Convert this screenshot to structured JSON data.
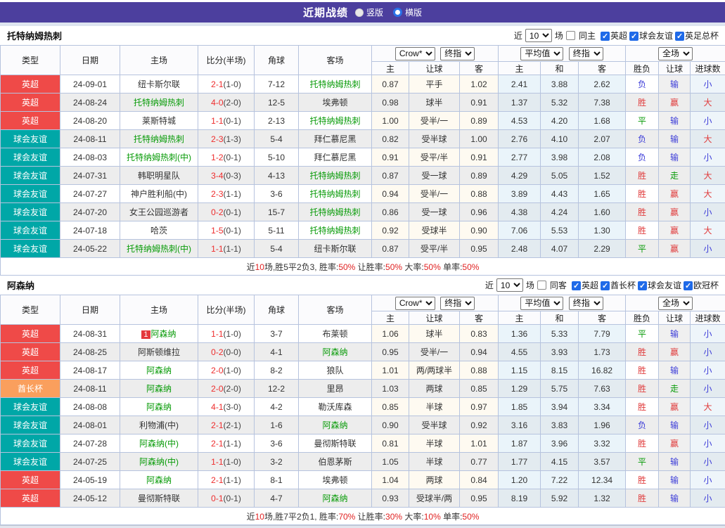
{
  "colors": {
    "topbar_purple": "#4c3f9e",
    "epl_red": "#ef4a48",
    "friendly_teal": "#00a7a7",
    "emirates_orange": "#fa9f5d",
    "team_green": "#089b08",
    "score_red": "#ee2c2c",
    "win_red": "#e03a3a",
    "lose_blue": "#3c3cd8",
    "draw_green": "#089b08",
    "border_blue": "#b6c3de"
  },
  "icons": {
    "checkbox_check": "✓",
    "radio_selected": "blue-ring-circle"
  },
  "topbar": {
    "title": "近期战绩",
    "radios": [
      {
        "label": "竖版",
        "checked": false
      },
      {
        "label": "横版",
        "checked": true
      }
    ]
  },
  "sections": [
    {
      "team": "托特纳姆热刺",
      "controls": {
        "near": "近",
        "count": "10",
        "games": "场",
        "same": "同主",
        "same_checked": false,
        "leagues": [
          "英超",
          "球会友谊",
          "英足总杯"
        ]
      },
      "columns": {
        "type": "类型",
        "date": "日期",
        "home": "主场",
        "score": "比分(半场)",
        "corner": "角球",
        "away": "客场"
      },
      "selects": {
        "book": "Crow*",
        "book_stage": "终指",
        "avg": "平均值",
        "avg_stage": "终指",
        "scope": "全场"
      },
      "sub_headers": [
        "主",
        "让球",
        "客",
        "主",
        "和",
        "客",
        "胜负",
        "让球",
        "进球数"
      ],
      "rows": [
        {
          "type": "英超",
          "tc": "epl",
          "date": "24-09-01",
          "badge": "",
          "home": "纽卡斯尔联",
          "home_green": false,
          "score": "2-1",
          "half": "(1-0)",
          "corner": "7-12",
          "away": "托特纳姆热刺",
          "away_green": true,
          "handicap": [
            "0.87",
            "平手",
            "1.02"
          ],
          "europe": [
            "2.41",
            "3.88",
            "2.62"
          ],
          "results": [
            [
              "负",
              "b"
            ],
            [
              "输",
              "b"
            ],
            [
              "小",
              "b"
            ]
          ]
        },
        {
          "type": "英超",
          "tc": "epl",
          "date": "24-08-24",
          "badge": "",
          "home": "托特纳姆热刺",
          "home_green": true,
          "score": "4-0",
          "half": "(2-0)",
          "corner": "12-5",
          "away": "埃弗顿",
          "away_green": false,
          "handicap": [
            "0.98",
            "球半",
            "0.91"
          ],
          "europe": [
            "1.37",
            "5.32",
            "7.38"
          ],
          "results": [
            [
              "胜",
              "r"
            ],
            [
              "赢",
              "r"
            ],
            [
              "大",
              "r"
            ]
          ]
        },
        {
          "type": "英超",
          "tc": "epl",
          "date": "24-08-20",
          "badge": "",
          "home": "莱斯特城",
          "home_green": false,
          "score": "1-1",
          "half": "(0-1)",
          "corner": "2-13",
          "away": "托特纳姆热刺",
          "away_green": true,
          "handicap": [
            "1.00",
            "受半/一",
            "0.89"
          ],
          "europe": [
            "4.53",
            "4.20",
            "1.68"
          ],
          "results": [
            [
              "平",
              "g"
            ],
            [
              "输",
              "b"
            ],
            [
              "小",
              "b"
            ]
          ]
        },
        {
          "type": "球会友谊",
          "tc": "fr",
          "date": "24-08-11",
          "badge": "",
          "home": "托特纳姆热刺",
          "home_green": true,
          "score": "2-3",
          "half": "(1-3)",
          "corner": "5-4",
          "away": "拜仁慕尼黑",
          "away_green": false,
          "handicap": [
            "0.82",
            "受半球",
            "1.00"
          ],
          "europe": [
            "2.76",
            "4.10",
            "2.07"
          ],
          "results": [
            [
              "负",
              "b"
            ],
            [
              "输",
              "b"
            ],
            [
              "大",
              "r"
            ]
          ]
        },
        {
          "type": "球会友谊",
          "tc": "fr",
          "date": "24-08-03",
          "badge": "",
          "home": "托特纳姆热刺(中)",
          "home_green": true,
          "score": "1-2",
          "half": "(0-1)",
          "corner": "5-10",
          "away": "拜仁慕尼黑",
          "away_green": false,
          "handicap": [
            "0.91",
            "受平/半",
            "0.91"
          ],
          "europe": [
            "2.77",
            "3.98",
            "2.08"
          ],
          "results": [
            [
              "负",
              "b"
            ],
            [
              "输",
              "b"
            ],
            [
              "小",
              "b"
            ]
          ]
        },
        {
          "type": "球会友谊",
          "tc": "fr",
          "date": "24-07-31",
          "badge": "",
          "home": "韩职明星队",
          "home_green": false,
          "score": "3-4",
          "half": "(0-3)",
          "corner": "4-13",
          "away": "托特纳姆热刺",
          "away_green": true,
          "handicap": [
            "0.87",
            "受一球",
            "0.89"
          ],
          "europe": [
            "4.29",
            "5.05",
            "1.52"
          ],
          "results": [
            [
              "胜",
              "r"
            ],
            [
              "走",
              "g"
            ],
            [
              "大",
              "r"
            ]
          ]
        },
        {
          "type": "球会友谊",
          "tc": "fr",
          "date": "24-07-27",
          "badge": "",
          "home": "神户胜利船(中)",
          "home_green": false,
          "score": "2-3",
          "half": "(1-1)",
          "corner": "3-6",
          "away": "托特纳姆热刺",
          "away_green": true,
          "handicap": [
            "0.94",
            "受半/一",
            "0.88"
          ],
          "europe": [
            "3.89",
            "4.43",
            "1.65"
          ],
          "results": [
            [
              "胜",
              "r"
            ],
            [
              "赢",
              "r"
            ],
            [
              "大",
              "r"
            ]
          ]
        },
        {
          "type": "球会友谊",
          "tc": "fr",
          "date": "24-07-20",
          "badge": "",
          "home": "女王公园巡游者",
          "home_green": false,
          "score": "0-2",
          "half": "(0-1)",
          "corner": "15-7",
          "away": "托特纳姆热刺",
          "away_green": true,
          "handicap": [
            "0.86",
            "受一球",
            "0.96"
          ],
          "europe": [
            "4.38",
            "4.24",
            "1.60"
          ],
          "results": [
            [
              "胜",
              "r"
            ],
            [
              "赢",
              "r"
            ],
            [
              "小",
              "b"
            ]
          ]
        },
        {
          "type": "球会友谊",
          "tc": "fr",
          "date": "24-07-18",
          "badge": "",
          "home": "哈茨",
          "home_green": false,
          "score": "1-5",
          "half": "(0-1)",
          "corner": "5-11",
          "away": "托特纳姆热刺",
          "away_green": true,
          "handicap": [
            "0.92",
            "受球半",
            "0.90"
          ],
          "europe": [
            "7.06",
            "5.53",
            "1.30"
          ],
          "results": [
            [
              "胜",
              "r"
            ],
            [
              "赢",
              "r"
            ],
            [
              "大",
              "r"
            ]
          ]
        },
        {
          "type": "球会友谊",
          "tc": "fr",
          "date": "24-05-22",
          "badge": "",
          "home": "托特纳姆热刺(中)",
          "home_green": true,
          "score": "1-1",
          "half": "(1-1)",
          "corner": "5-4",
          "away": "纽卡斯尔联",
          "away_green": false,
          "handicap": [
            "0.87",
            "受平/半",
            "0.95"
          ],
          "europe": [
            "2.48",
            "4.07",
            "2.29"
          ],
          "results": [
            [
              "平",
              "g"
            ],
            [
              "赢",
              "r"
            ],
            [
              "小",
              "b"
            ]
          ]
        }
      ],
      "summary": [
        [
          "近",
          false
        ],
        [
          "10",
          true
        ],
        [
          "场,胜5平2负3, 胜率:",
          false
        ],
        [
          "50%",
          true
        ],
        [
          " 让胜率:",
          false
        ],
        [
          "50%",
          true
        ],
        [
          " 大率:",
          false
        ],
        [
          "50%",
          true
        ],
        [
          " 单率:",
          false
        ],
        [
          "50%",
          true
        ]
      ]
    },
    {
      "team": "阿森纳",
      "controls": {
        "near": "近",
        "count": "10",
        "games": "场",
        "same": "同客",
        "same_checked": false,
        "leagues": [
          "英超",
          "酋长杯",
          "球会友谊",
          "欧冠杯"
        ]
      },
      "columns": {
        "type": "类型",
        "date": "日期",
        "home": "主场",
        "score": "比分(半场)",
        "corner": "角球",
        "away": "客场"
      },
      "selects": {
        "book": "Crow*",
        "book_stage": "终指",
        "avg": "平均值",
        "avg_stage": "终指",
        "scope": "全场"
      },
      "sub_headers": [
        "主",
        "让球",
        "客",
        "主",
        "和",
        "客",
        "胜负",
        "让球",
        "进球数"
      ],
      "rows": [
        {
          "type": "英超",
          "tc": "epl",
          "date": "24-08-31",
          "badge": "1",
          "home": "阿森纳",
          "home_green": true,
          "score": "1-1",
          "half": "(1-0)",
          "corner": "3-7",
          "away": "布莱顿",
          "away_green": false,
          "handicap": [
            "1.06",
            "球半",
            "0.83"
          ],
          "europe": [
            "1.36",
            "5.33",
            "7.79"
          ],
          "results": [
            [
              "平",
              "g"
            ],
            [
              "输",
              "b"
            ],
            [
              "小",
              "b"
            ]
          ]
        },
        {
          "type": "英超",
          "tc": "epl",
          "date": "24-08-25",
          "badge": "",
          "home": "阿斯顿维拉",
          "home_green": false,
          "score": "0-2",
          "half": "(0-0)",
          "corner": "4-1",
          "away": "阿森纳",
          "away_green": true,
          "handicap": [
            "0.95",
            "受半/一",
            "0.94"
          ],
          "europe": [
            "4.55",
            "3.93",
            "1.73"
          ],
          "results": [
            [
              "胜",
              "r"
            ],
            [
              "赢",
              "r"
            ],
            [
              "小",
              "b"
            ]
          ]
        },
        {
          "type": "英超",
          "tc": "epl",
          "date": "24-08-17",
          "badge": "",
          "home": "阿森纳",
          "home_green": true,
          "score": "2-0",
          "half": "(1-0)",
          "corner": "8-2",
          "away": "狼队",
          "away_green": false,
          "handicap": [
            "1.01",
            "两/两球半",
            "0.88"
          ],
          "europe": [
            "1.15",
            "8.15",
            "16.82"
          ],
          "results": [
            [
              "胜",
              "r"
            ],
            [
              "输",
              "b"
            ],
            [
              "小",
              "b"
            ]
          ]
        },
        {
          "type": "酋长杯",
          "tc": "em",
          "date": "24-08-11",
          "badge": "",
          "home": "阿森纳",
          "home_green": true,
          "score": "2-0",
          "half": "(2-0)",
          "corner": "12-2",
          "away": "里昂",
          "away_green": false,
          "handicap": [
            "1.03",
            "两球",
            "0.85"
          ],
          "europe": [
            "1.29",
            "5.75",
            "7.63"
          ],
          "results": [
            [
              "胜",
              "r"
            ],
            [
              "走",
              "g"
            ],
            [
              "小",
              "b"
            ]
          ]
        },
        {
          "type": "球会友谊",
          "tc": "fr",
          "date": "24-08-08",
          "badge": "",
          "home": "阿森纳",
          "home_green": true,
          "score": "4-1",
          "half": "(3-0)",
          "corner": "4-2",
          "away": "勒沃库森",
          "away_green": false,
          "handicap": [
            "0.85",
            "半球",
            "0.97"
          ],
          "europe": [
            "1.85",
            "3.94",
            "3.34"
          ],
          "results": [
            [
              "胜",
              "r"
            ],
            [
              "赢",
              "r"
            ],
            [
              "大",
              "r"
            ]
          ]
        },
        {
          "type": "球会友谊",
          "tc": "fr",
          "date": "24-08-01",
          "badge": "",
          "home": "利物浦(中)",
          "home_green": false,
          "score": "2-1",
          "half": "(2-1)",
          "corner": "1-6",
          "away": "阿森纳",
          "away_green": true,
          "handicap": [
            "0.90",
            "受半球",
            "0.92"
          ],
          "europe": [
            "3.16",
            "3.83",
            "1.96"
          ],
          "results": [
            [
              "负",
              "b"
            ],
            [
              "输",
              "b"
            ],
            [
              "小",
              "b"
            ]
          ]
        },
        {
          "type": "球会友谊",
          "tc": "fr",
          "date": "24-07-28",
          "badge": "",
          "home": "阿森纳(中)",
          "home_green": true,
          "score": "2-1",
          "half": "(1-1)",
          "corner": "3-6",
          "away": "曼彻斯特联",
          "away_green": false,
          "handicap": [
            "0.81",
            "半球",
            "1.01"
          ],
          "europe": [
            "1.87",
            "3.96",
            "3.32"
          ],
          "results": [
            [
              "胜",
              "r"
            ],
            [
              "赢",
              "r"
            ],
            [
              "小",
              "b"
            ]
          ]
        },
        {
          "type": "球会友谊",
          "tc": "fr",
          "date": "24-07-25",
          "badge": "",
          "home": "阿森纳(中)",
          "home_green": true,
          "score": "1-1",
          "half": "(1-0)",
          "corner": "3-2",
          "away": "伯恩茅斯",
          "away_green": false,
          "handicap": [
            "1.05",
            "半球",
            "0.77"
          ],
          "europe": [
            "1.77",
            "4.15",
            "3.57"
          ],
          "results": [
            [
              "平",
              "g"
            ],
            [
              "输",
              "b"
            ],
            [
              "小",
              "b"
            ]
          ]
        },
        {
          "type": "英超",
          "tc": "epl",
          "date": "24-05-19",
          "badge": "",
          "home": "阿森纳",
          "home_green": true,
          "score": "2-1",
          "half": "(1-1)",
          "corner": "8-1",
          "away": "埃弗顿",
          "away_green": false,
          "handicap": [
            "1.04",
            "两球",
            "0.84"
          ],
          "europe": [
            "1.20",
            "7.22",
            "12.34"
          ],
          "results": [
            [
              "胜",
              "r"
            ],
            [
              "输",
              "b"
            ],
            [
              "小",
              "b"
            ]
          ]
        },
        {
          "type": "英超",
          "tc": "epl",
          "date": "24-05-12",
          "badge": "",
          "home": "曼彻斯特联",
          "home_green": false,
          "score": "0-1",
          "half": "(0-1)",
          "corner": "4-7",
          "away": "阿森纳",
          "away_green": true,
          "handicap": [
            "0.93",
            "受球半/两",
            "0.95"
          ],
          "europe": [
            "8.19",
            "5.92",
            "1.32"
          ],
          "results": [
            [
              "胜",
              "r"
            ],
            [
              "输",
              "b"
            ],
            [
              "小",
              "b"
            ]
          ]
        }
      ],
      "summary": [
        [
          "近",
          false
        ],
        [
          "10",
          true
        ],
        [
          "场,胜7平2负1, 胜率:",
          false
        ],
        [
          "70%",
          true
        ],
        [
          " 让胜率:",
          false
        ],
        [
          "30%",
          true
        ],
        [
          " 大率:",
          false
        ],
        [
          "10%",
          true
        ],
        [
          " 单率:",
          false
        ],
        [
          "50%",
          true
        ]
      ]
    }
  ]
}
